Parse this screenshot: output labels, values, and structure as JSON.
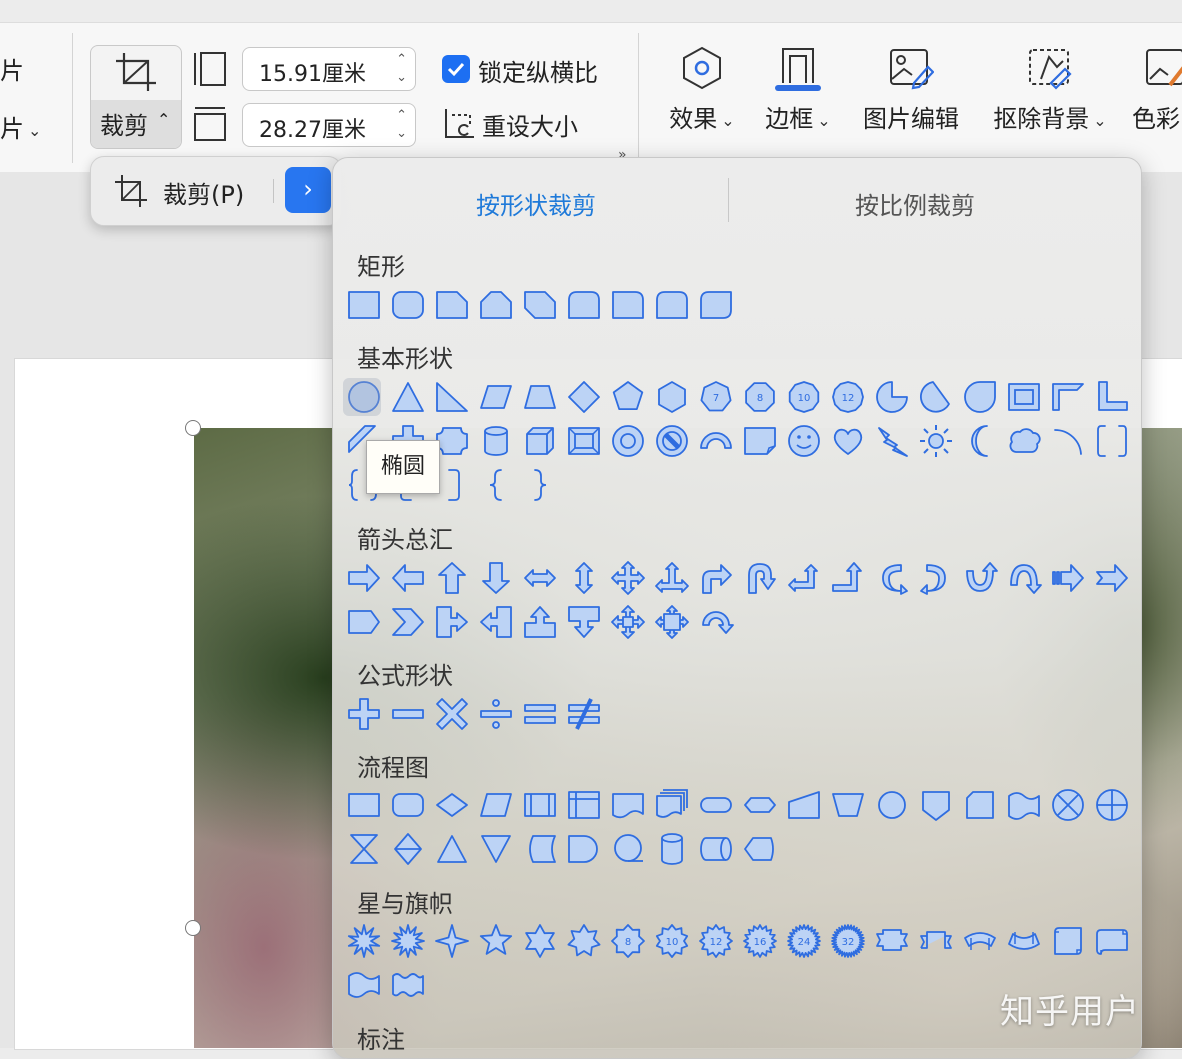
{
  "ribbon": {
    "left_cut_top": "片",
    "left_cut_bottom": "片",
    "crop_label": "裁剪",
    "width_value": "15.91厘米",
    "height_value": "28.27厘米",
    "lock_aspect_label": "锁定纵横比",
    "reset_size_label": "重设大小",
    "tools": [
      {
        "label": "效果",
        "icon": "effects-icon",
        "dropdown": true
      },
      {
        "label": "边框",
        "icon": "border-icon",
        "dropdown": true
      },
      {
        "label": "图片编辑",
        "icon": "image-edit-icon",
        "dropdown": false
      },
      {
        "label": "抠除背景",
        "icon": "remove-background-icon",
        "dropdown": true
      },
      {
        "label": "色彩",
        "icon": "color-icon",
        "dropdown": false
      }
    ]
  },
  "crop_menu": {
    "item_label": "裁剪(P)",
    "expand_glyph": "›"
  },
  "crop_panel": {
    "tab_shape": "按形状裁剪",
    "tab_ratio": "按比例裁剪",
    "categories": {
      "rect": "矩形",
      "basic": "基本形状",
      "arrows": "箭头总汇",
      "equation": "公式形状",
      "flowchart": "流程图",
      "stars": "星与旗帜",
      "callouts": "标注"
    },
    "tooltip": "椭圆",
    "shape_numbers": [
      "7",
      "8",
      "10",
      "12"
    ],
    "star_numbers": [
      "8",
      "10",
      "12",
      "16",
      "24",
      "32"
    ]
  },
  "watermark": "知乎用户",
  "colors": {
    "accent": "#1d6ff2",
    "shape_stroke": "#2f6de0",
    "shape_fill": "#bcd3f5",
    "tab_active": "#1f7ad9"
  }
}
